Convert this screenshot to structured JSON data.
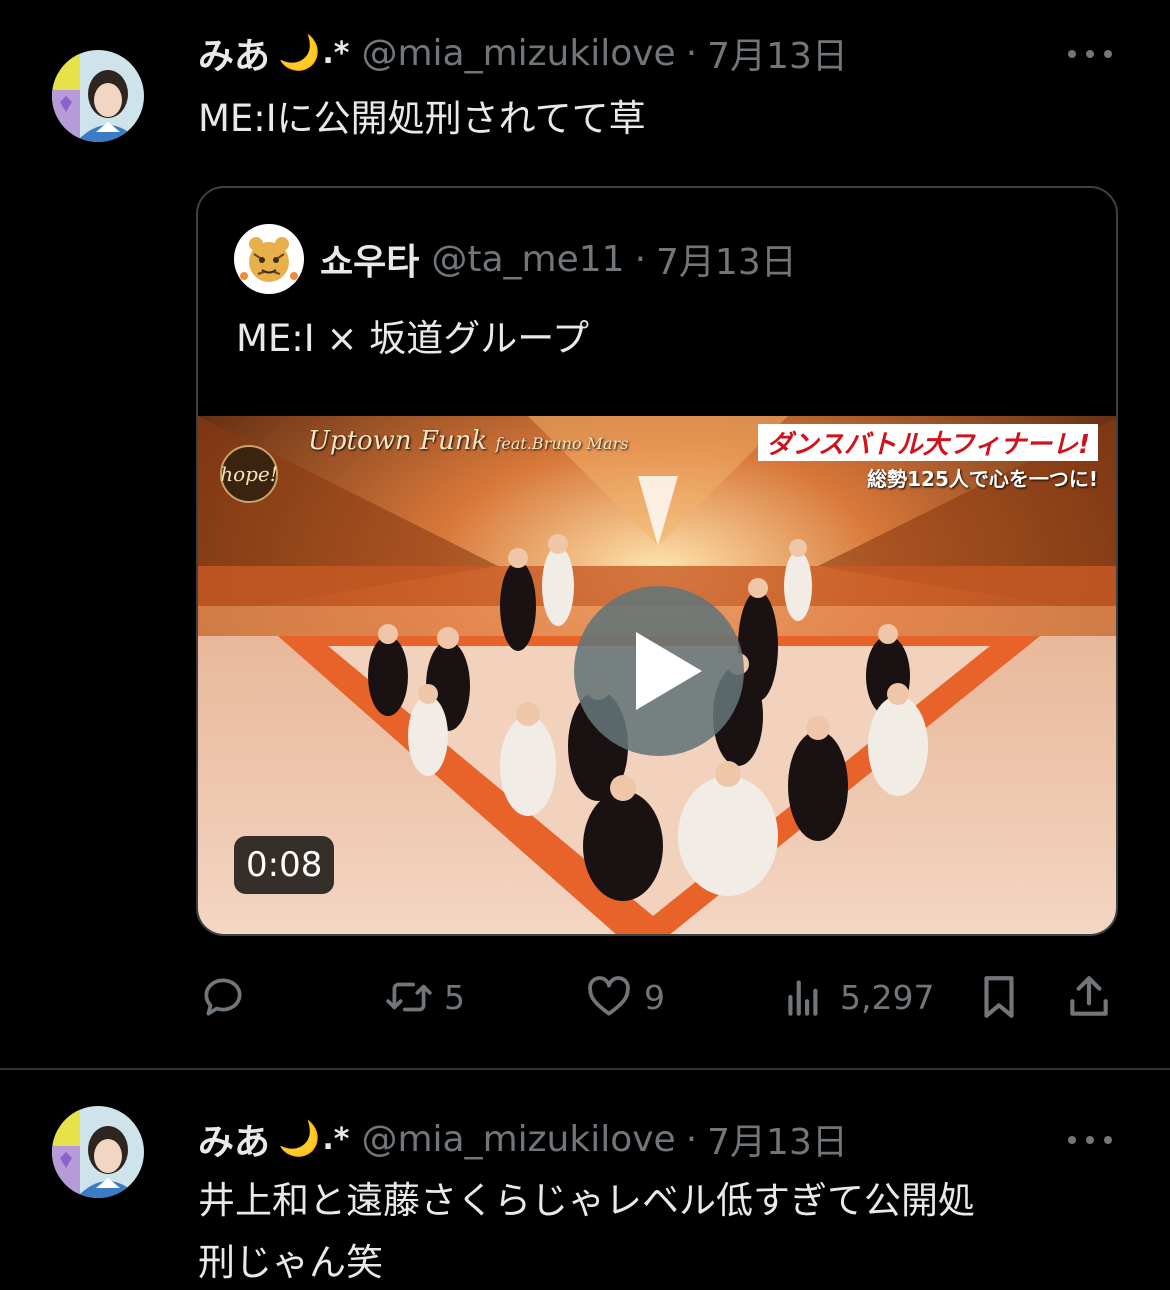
{
  "tweets": [
    {
      "author_name": "みあ",
      "author_emoji": "🌙",
      "author_suffix": ".*",
      "handle": "@mia_mizukilove",
      "separator": "·",
      "date": "7月13日",
      "text": "ME:Iに公開処刑されてて草",
      "quote": {
        "author_name": "쇼우타",
        "handle": "@ta_me11",
        "separator": "·",
        "date": "7月13日",
        "text": "ME:I × 坂道グループ",
        "video": {
          "duration": "0:08",
          "overlay_left_title": "Uptown Funk",
          "overlay_left_sub": "feat.Bruno Mars",
          "overlay_right_title": "ダンスバトル大フィナーレ!",
          "overlay_right_sub": "総勢125人で心を一つに!",
          "logo_text": "hope!"
        }
      },
      "actions": {
        "reply_count": "",
        "retweet_count": "5",
        "like_count": "9",
        "views_count": "5,297"
      }
    },
    {
      "author_name": "みあ",
      "author_emoji": "🌙",
      "author_suffix": ".*",
      "handle": "@mia_mizukilove",
      "separator": "·",
      "date": "7月13日",
      "text_line1": "井上和と遠藤さくらじゃレベル低すぎて公開処",
      "text_line2": "刑じゃん笑"
    }
  ],
  "icons": {
    "more": "more-dots-icon",
    "reply": "reply-icon",
    "retweet": "retweet-icon",
    "like": "heart-icon",
    "views": "views-icon",
    "bookmark": "bookmark-icon",
    "share": "share-icon",
    "play": "play-icon"
  },
  "colors": {
    "background": "#000000",
    "primary_text": "#e7e9ea",
    "secondary_text": "#71767b",
    "border": "#2f3336"
  }
}
